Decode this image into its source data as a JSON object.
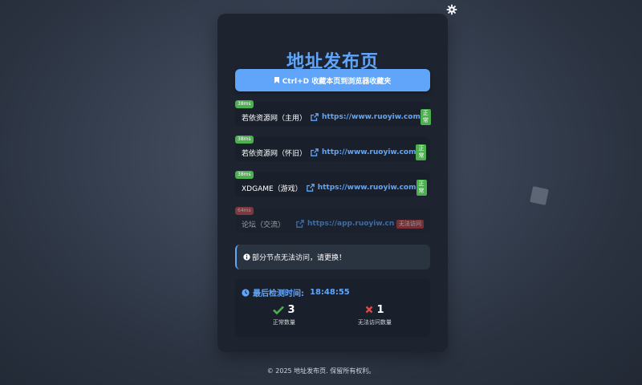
{
  "title": "地址发布页",
  "bookmark_button": {
    "label": "Ctrl+D 收藏本页到浏览器收藏夹"
  },
  "links": [
    {
      "latency": "38ms",
      "name": "若依资源网（主用）",
      "url": "https://www.ruoyiw.com",
      "status": "正常",
      "ok": true
    },
    {
      "latency": "38ms",
      "name": "若依资源网（怀旧）",
      "url": "http://www.ruoyiw.com",
      "status": "正常",
      "ok": true
    },
    {
      "latency": "38ms",
      "name": "XDGAME（游戏）",
      "url": "https://www.ruoyiw.com",
      "status": "正常",
      "ok": true
    },
    {
      "latency": "64ms",
      "name": "论坛（交流）",
      "url": "https://app.ruoyiw.cn",
      "status": "无法访问",
      "ok": false
    }
  ],
  "notice": {
    "text": "部分节点无法访问，请更换！"
  },
  "stats": {
    "check_label": "最后检测时间:",
    "check_time": "18:48:55",
    "ok_count": "3",
    "ok_label": "正常数量",
    "bad_count": "1",
    "bad_label": "无法访问数量"
  },
  "footer": {
    "text": "© 2025 地址发布页. 保留所有权利。"
  },
  "colors": {
    "accent": "#60a5fa",
    "ok": "#4caf50",
    "bad": "#d04848",
    "card": "#1d2430"
  },
  "icons": {
    "settings": "gear-icon",
    "bookmark": "bookmark-icon",
    "link": "external-link-icon",
    "info": "info-icon",
    "clock": "clock-icon",
    "check": "check-icon",
    "cross": "cross-icon"
  }
}
